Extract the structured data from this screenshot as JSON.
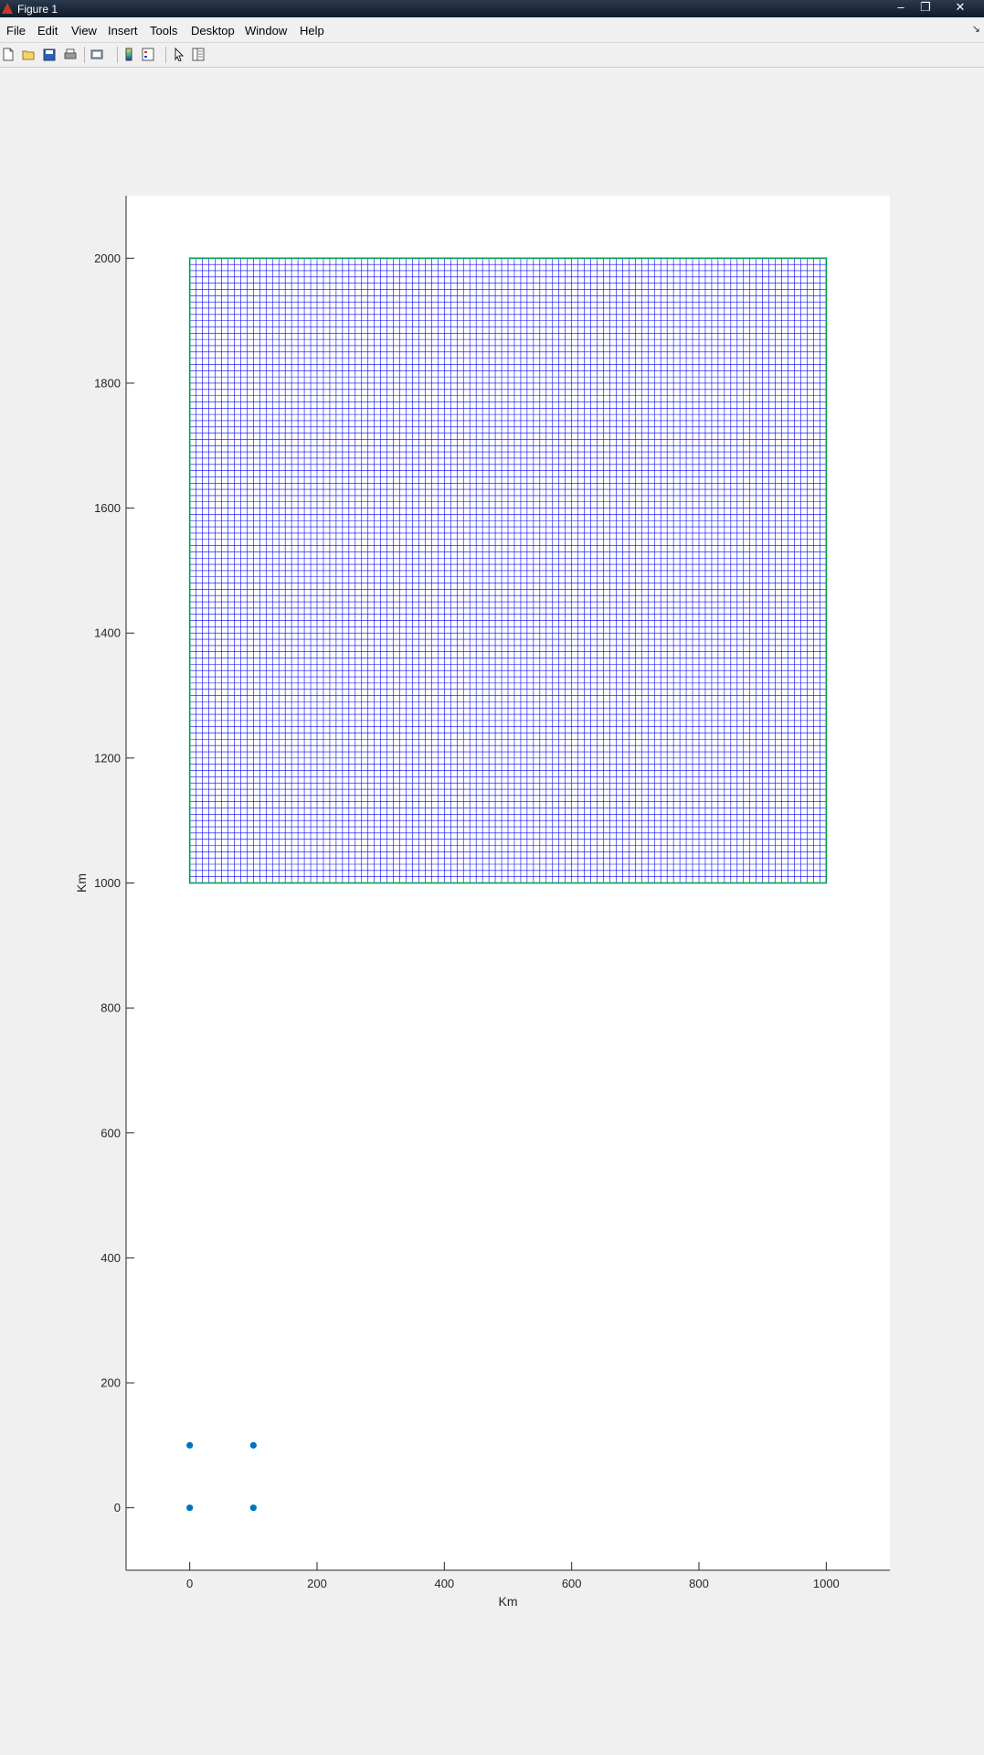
{
  "window": {
    "title": "Figure 1",
    "minimize_glyph": "‒",
    "maximize_glyph": "❐",
    "close_glyph": "✕"
  },
  "menu": {
    "items": [
      "File",
      "Edit",
      "View",
      "Insert",
      "Tools",
      "Desktop",
      "Window",
      "Help"
    ],
    "corner_glyph": "↘"
  },
  "toolbar": {
    "icons": [
      "new-figure-icon",
      "open-file-icon",
      "save-icon",
      "print-icon",
      "print-preview-icon",
      "insert-colorbar-icon",
      "insert-legend-icon",
      "edit-plot-pointer-icon",
      "property-editor-icon"
    ]
  },
  "chart_data": {
    "type": "scatter",
    "title": "",
    "xlabel": "Km",
    "ylabel": "Km",
    "xlim": [
      -100,
      1100
    ],
    "ylim": [
      -100,
      2100
    ],
    "xticks": [
      0,
      200,
      400,
      600,
      800,
      1000
    ],
    "yticks": [
      0,
      200,
      400,
      600,
      800,
      1000,
      1200,
      1400,
      1600,
      1800,
      2000
    ],
    "grid": false,
    "series": [
      {
        "type": "scatter",
        "color": "#0072bd",
        "points": [
          [
            0,
            0
          ],
          [
            100,
            0
          ],
          [
            0,
            100
          ],
          [
            100,
            100
          ]
        ]
      },
      {
        "type": "mesh",
        "color": "#0000ff",
        "x_range": [
          0,
          1000
        ],
        "y_range": [
          1000,
          2000
        ],
        "x_lines": 101,
        "y_lines": 101
      },
      {
        "type": "boundary",
        "color": "#00a050",
        "x_range": [
          0,
          1000
        ],
        "y_range": [
          1000,
          2000
        ]
      }
    ]
  }
}
